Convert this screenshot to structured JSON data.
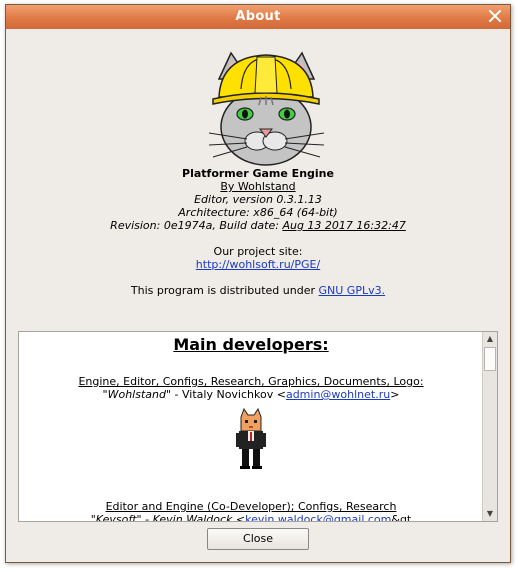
{
  "window": {
    "title": "About"
  },
  "app": {
    "name": "Platformer Game Engine",
    "author": "By Wohlstand",
    "version": "Editor, version 0.3.1.13",
    "architecture": "Architecture: x86_64 (64-bit)",
    "revision_prefix": "Revision: 0e1974a, Build date: ",
    "build_date": "Aug 13 2017 16:32:47",
    "site_label": "Our project site:",
    "site_url": "http://wohlsoft.ru/PGE/",
    "license_prefix": "This program is distributed under ",
    "license": "GNU GPLv3."
  },
  "developers": {
    "heading": "Main developers:",
    "entries": [
      {
        "roles": "Engine, Editor, Configs, Research, Graphics, Documents, Logo:",
        "nick": "\"Wohlstand\"",
        "name": " - Vitaly Novichkov <",
        "email": "admin@wohlnet.ru",
        "suffix": ">"
      },
      {
        "roles": "Editor and Engine (Co-Developer); Configs, Research",
        "nick": "\"Kevsoft\"",
        "name": " - Kevin Waldock  <",
        "email": "kevin.waldock@gmail.com",
        "suffix": "&gt"
      }
    ]
  },
  "buttons": {
    "close": "Close"
  },
  "icons": {
    "logo": "cat-with-helmet-logo",
    "close": "close-x-icon"
  }
}
